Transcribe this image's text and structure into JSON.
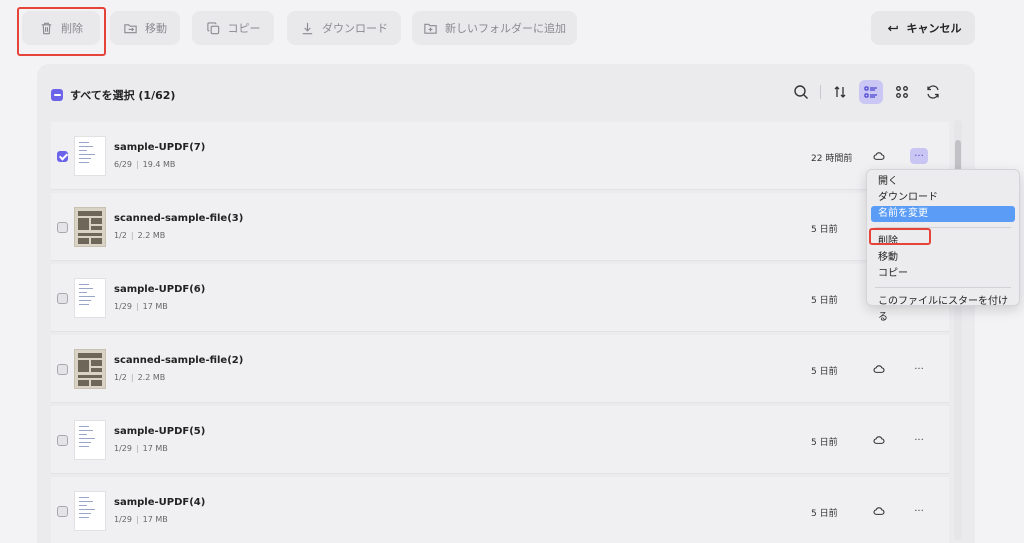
{
  "toolbar": {
    "delete_label": "削除",
    "move_label": "移動",
    "copy_label": "コピー",
    "download_label": "ダウンロード",
    "add_to_folder_label": "新しいフォルダーに追加",
    "cancel_label": "キャンセル"
  },
  "list_header": {
    "select_all_label": "すべてを選択 (1/62)",
    "icons": [
      "search-icon",
      "sort-icon",
      "list-view-icon",
      "grid-view-icon",
      "refresh-icon"
    ],
    "active_view": "list-view-icon"
  },
  "files": [
    {
      "name": "sample-UPDF(7)",
      "pages": "6/29",
      "size": "19.4 MB",
      "time": "22 時間前",
      "checked": true,
      "thumb": "doc"
    },
    {
      "name": "scanned-sample-file(3)",
      "pages": "1/2",
      "size": "2.2 MB",
      "time": "5 日前",
      "checked": false,
      "thumb": "scan"
    },
    {
      "name": "sample-UPDF(6)",
      "pages": "1/29",
      "size": "17 MB",
      "time": "5 日前",
      "checked": false,
      "thumb": "doc"
    },
    {
      "name": "scanned-sample-file(2)",
      "pages": "1/2",
      "size": "2.2 MB",
      "time": "5 日前",
      "checked": false,
      "thumb": "scan"
    },
    {
      "name": "sample-UPDF(5)",
      "pages": "1/29",
      "size": "17 MB",
      "time": "5 日前",
      "checked": false,
      "thumb": "doc"
    },
    {
      "name": "sample-UPDF(4)",
      "pages": "1/29",
      "size": "17 MB",
      "time": "5 日前",
      "checked": false,
      "thumb": "doc"
    }
  ],
  "meta_separator": "|",
  "more_glyph": "···",
  "context_menu": {
    "items": [
      "開く",
      "ダウンロード",
      "名前を変更",
      "削除",
      "移動",
      "コピー",
      "このファイルにスターを付ける"
    ],
    "selected": "名前を変更",
    "highlighted": "削除"
  },
  "colors": {
    "accent": "#6b63e9",
    "highlight_red": "#e5443b",
    "menu_selected": "#5b9cf6"
  }
}
